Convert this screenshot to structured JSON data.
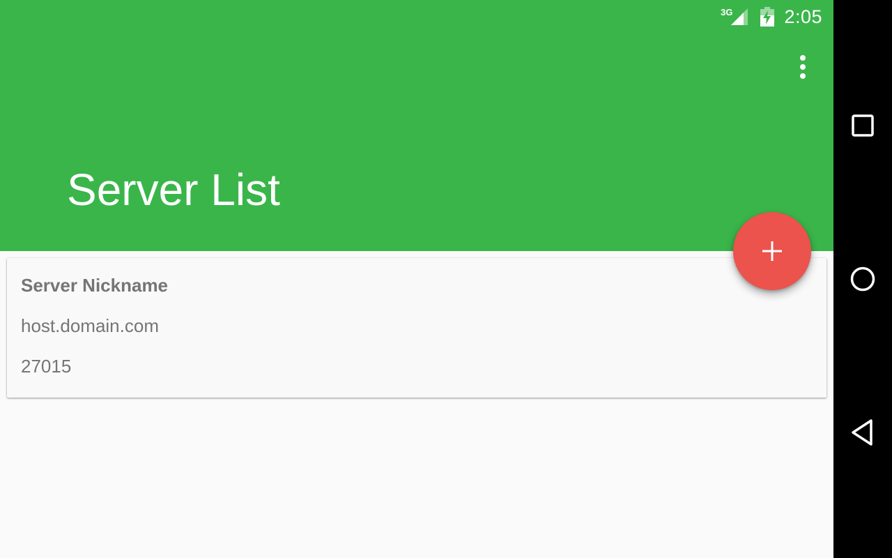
{
  "status_bar": {
    "network": "3G",
    "time": "2:05"
  },
  "app_bar": {
    "title": "Server List",
    "overflow_icon": "more-vert-icon",
    "color": "#3ab54a"
  },
  "servers": [
    {
      "nickname": "Server Nickname",
      "host": "host.domain.com",
      "port": "27015"
    }
  ],
  "fab": {
    "icon": "plus-icon",
    "color": "#eb534c"
  },
  "nav_bar": {
    "buttons": [
      "recents-icon",
      "home-icon",
      "back-icon"
    ]
  }
}
